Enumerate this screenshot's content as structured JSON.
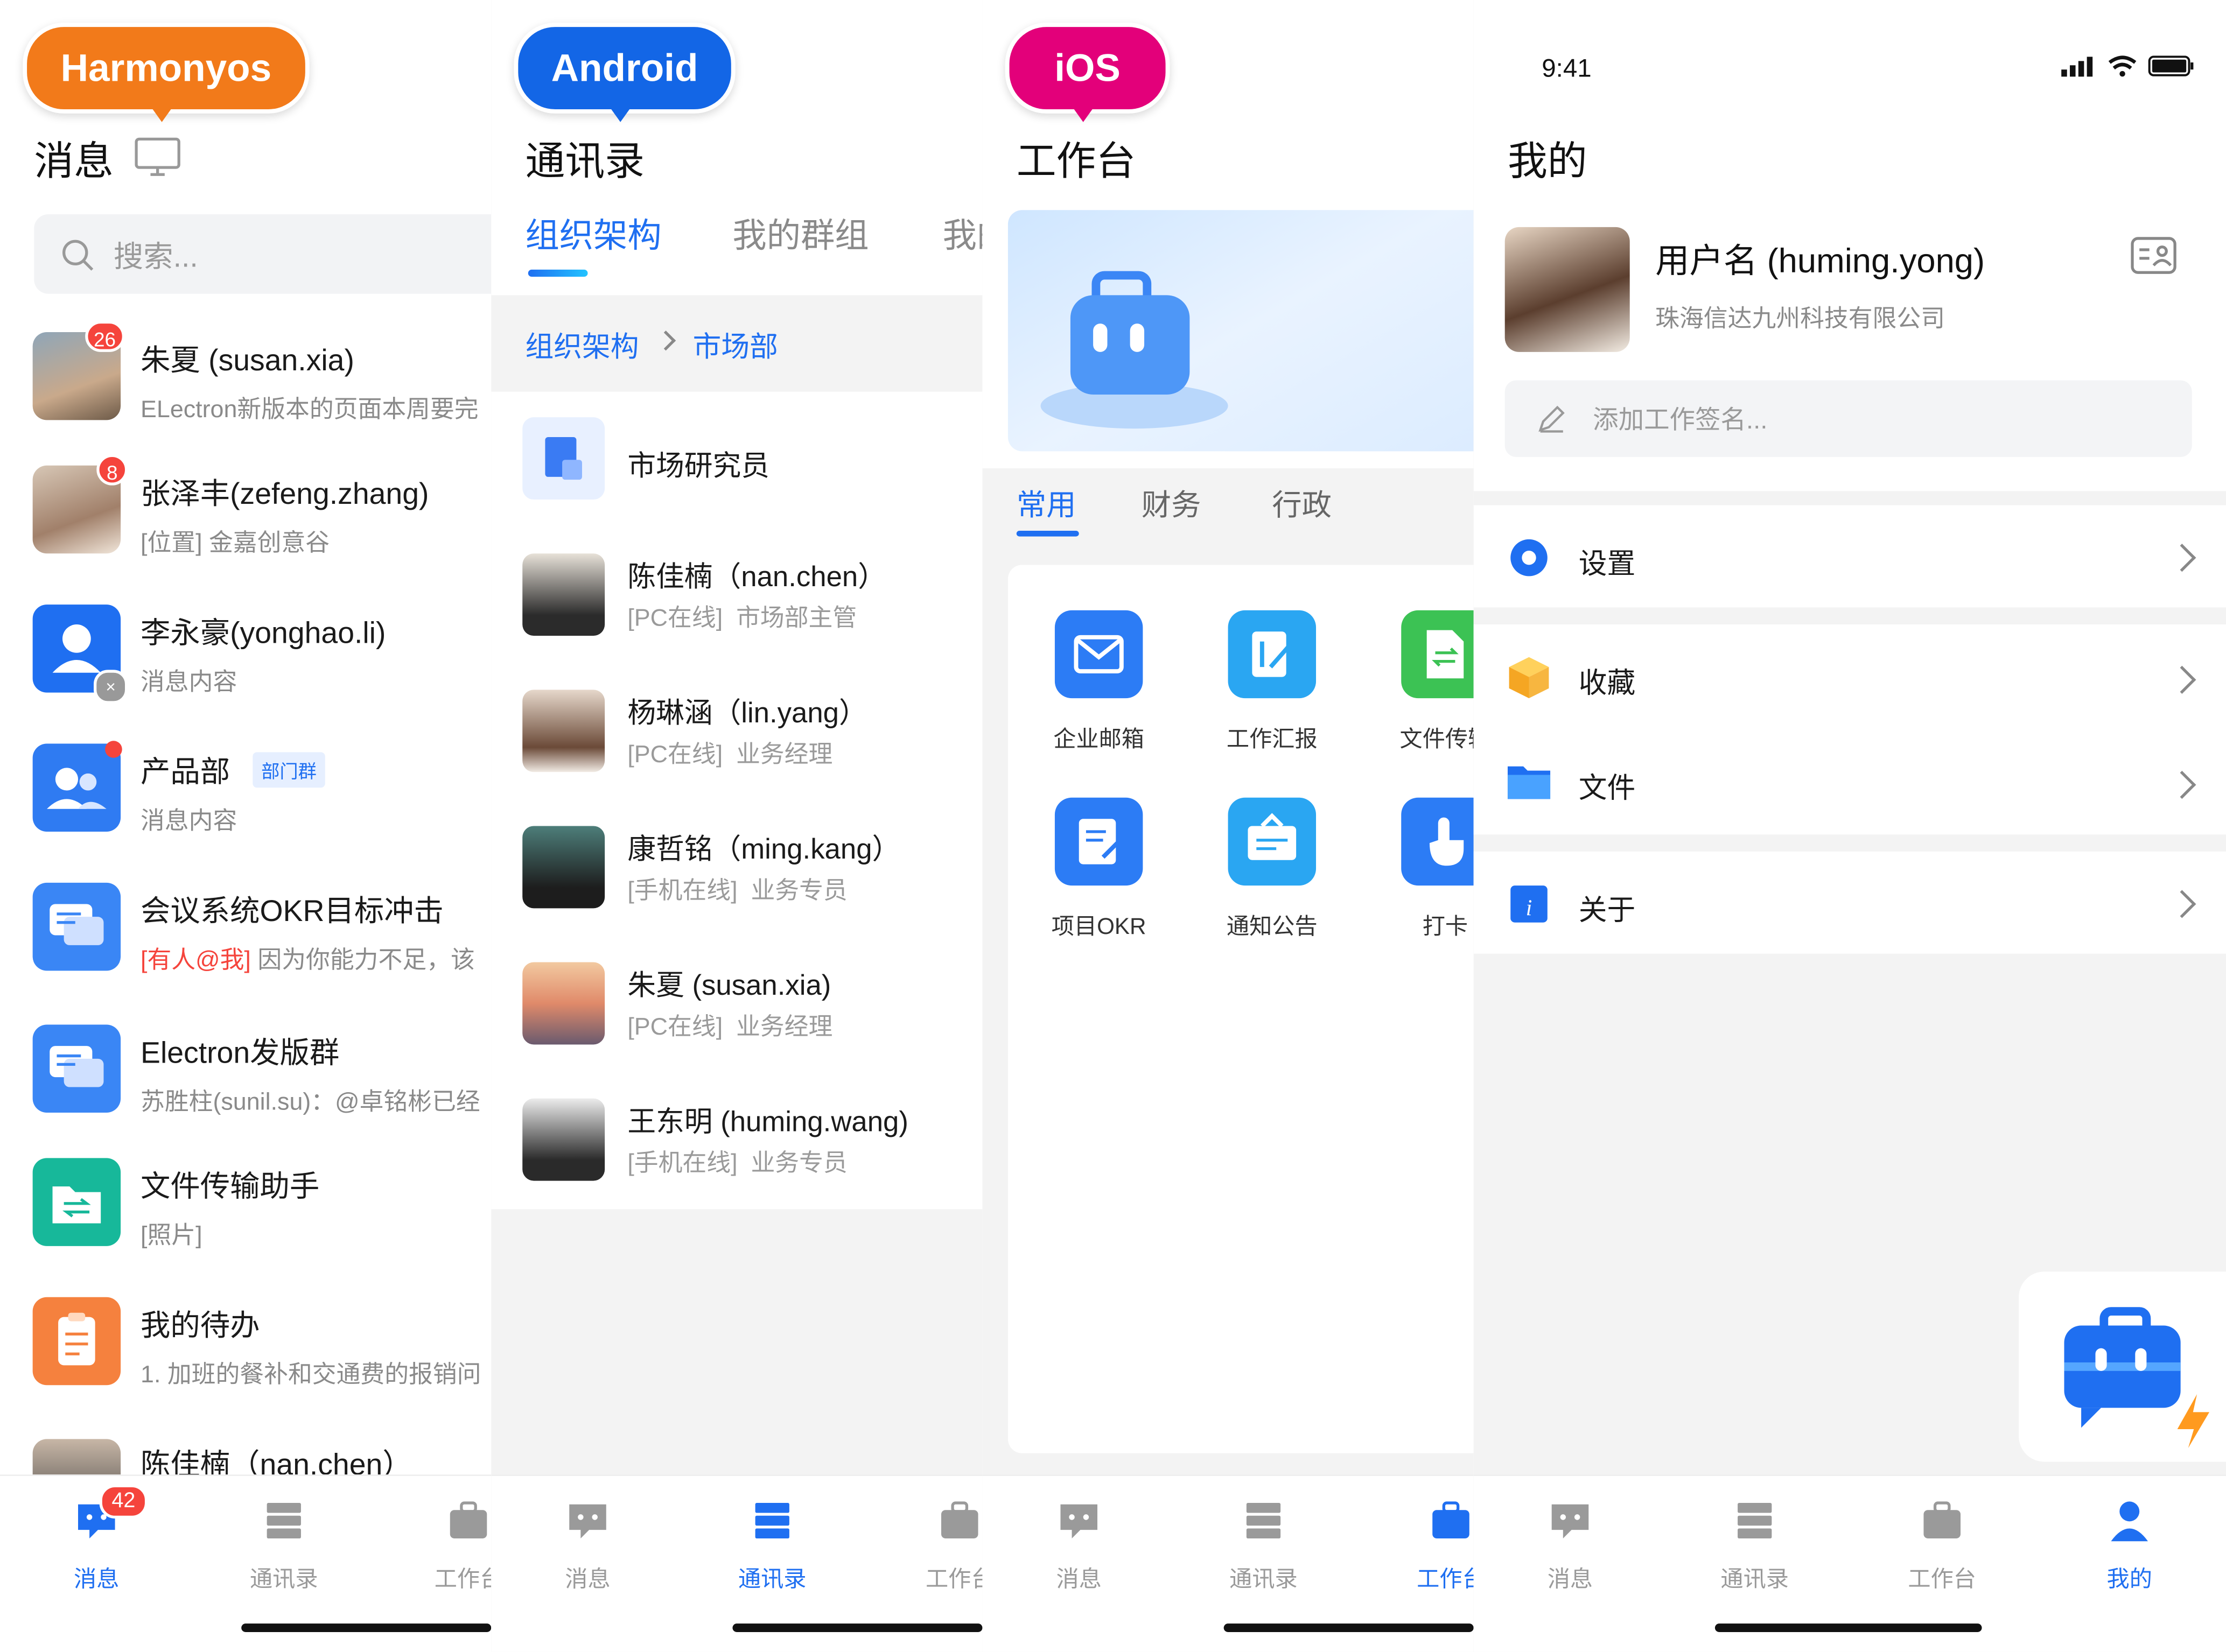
{
  "platforms": {
    "harmony": "Harmonyos",
    "android": "Android",
    "ios": "iOS"
  },
  "colors": {
    "harmony": "#f27a1a",
    "android": "#1366e6",
    "ios": "#e3007a",
    "accent": "#1f6ff1",
    "red_badge": "#f5443c"
  },
  "harmony": {
    "title": "消息",
    "search_placeholder": "搜索...",
    "conversations": [
      {
        "name": "朱夏 (susan.xia)",
        "message": "ELectron新版本的页面本周要完",
        "badge": "26"
      },
      {
        "name": "张泽丰(zefeng.zhang)",
        "message": "[位置] 金嘉创意谷",
        "badge": "8"
      },
      {
        "name": "李永豪(yonghao.li)",
        "message": "消息内容"
      },
      {
        "name": "产品部",
        "tag": "部门群",
        "message": "消息内容"
      },
      {
        "name": "会议系统OKR目标冲击",
        "mention": "[有人@我]",
        "message": "因为你能力不足，该"
      },
      {
        "name": "Electron发版群",
        "message": "苏胜柱(sunil.su)：@卓铭彬已经"
      },
      {
        "name": "文件传输助手",
        "message": "[照片]"
      },
      {
        "name": "我的待办",
        "message": "1. 加班的餐补和交通费的报销问"
      },
      {
        "name": "陈佳楠（nan.chen）"
      }
    ],
    "tabs": [
      {
        "label": "消息",
        "badge": "42"
      },
      {
        "label": "通讯录"
      },
      {
        "label": "工作台"
      }
    ]
  },
  "android": {
    "title": "通讯录",
    "top_tabs": [
      "组织架构",
      "我的群组",
      "我的"
    ],
    "breadcrumb": [
      "组织架构",
      "市场部"
    ],
    "dept": "市场研究员",
    "contacts": [
      {
        "name": "陈佳楠（nan.chen）",
        "status": "[PC在线]",
        "role": "市场部主管"
      },
      {
        "name": "杨琳涵（lin.yang）",
        "status": "[PC在线]",
        "role": "业务经理"
      },
      {
        "name": "康哲铭（ming.kang）",
        "status": "[手机在线]",
        "role": "业务专员"
      },
      {
        "name": "朱夏 (susan.xia)",
        "status": "[PC在线]",
        "role": "业务经理"
      },
      {
        "name": "王东明 (huming.wang)",
        "status": "[手机在线]",
        "role": "业务专员"
      }
    ],
    "tabs": [
      "消息",
      "通讯录",
      "工作台"
    ]
  },
  "ios": {
    "title": "工作台",
    "cat_tabs": [
      "常用",
      "财务",
      "行政"
    ],
    "apps": [
      "企业邮箱",
      "工作汇报",
      "文件传输",
      "项目OKR",
      "通知公告",
      "打卡"
    ],
    "tabs": [
      "消息",
      "通讯录",
      "工作台"
    ]
  },
  "mine": {
    "time": "9:41",
    "title": "我的",
    "username": "用户名 (huming.yong)",
    "company": "珠海信达九州科技有限公司",
    "signature_placeholder": "添加工作签名...",
    "menu": [
      "设置",
      "收藏",
      "文件",
      "关于"
    ],
    "tabs": [
      "消息",
      "通讯录",
      "工作台",
      "我的"
    ]
  }
}
